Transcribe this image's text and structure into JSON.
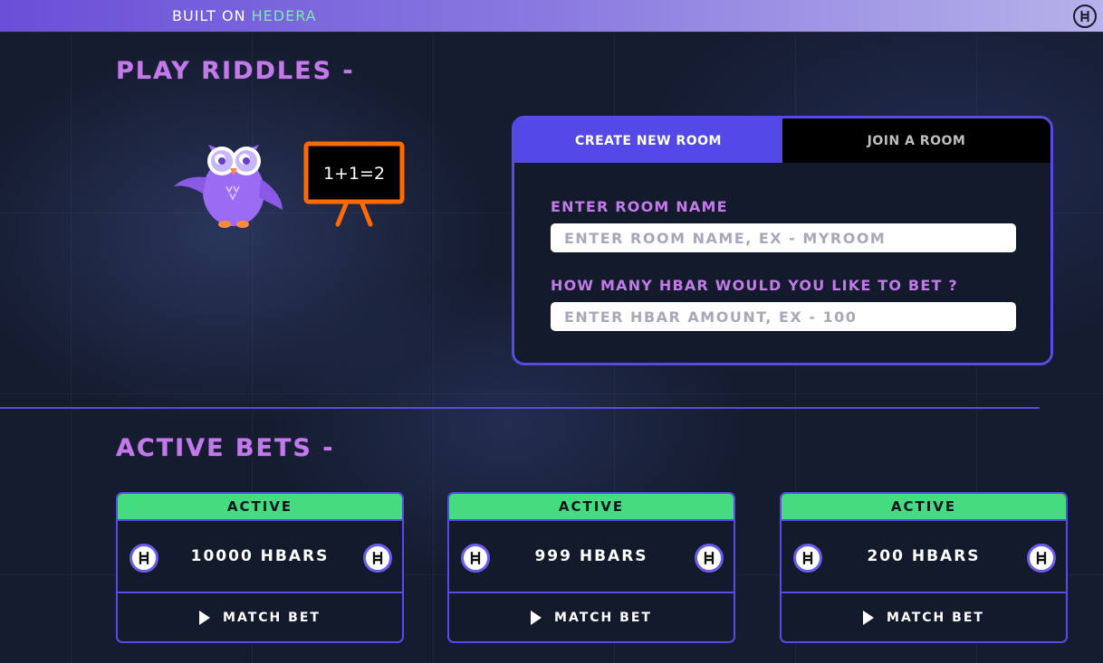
{
  "header": {
    "built_on_prefix": "BUILT ON ",
    "built_on_brand": "HEDERA",
    "logo_icon": "hbar-icon"
  },
  "play_section": {
    "title": "PLAY RIDDLES -",
    "board_text": "1+1=2"
  },
  "room_panel": {
    "tabs": [
      {
        "label": "CREATE NEW ROOM",
        "active": true
      },
      {
        "label": "JOIN A ROOM",
        "active": false
      }
    ],
    "room_name_label": "ENTER ROOM NAME",
    "room_name_placeholder": "ENTER ROOM NAME, EX - MYROOM",
    "room_name_value": "",
    "bet_label": "HOW MANY HBAR WOULD YOU LIKE TO BET ?",
    "bet_placeholder": "ENTER HBAR AMOUNT, EX - 100",
    "bet_value": ""
  },
  "active_bets": {
    "title": "ACTIVE BETS -",
    "bets": [
      {
        "status": "ACTIVE",
        "amount": "10000 HBARS",
        "action": "MATCH BET"
      },
      {
        "status": "ACTIVE",
        "amount": "999 HBARS",
        "action": "MATCH BET"
      },
      {
        "status": "ACTIVE",
        "amount": "200 HBARS",
        "action": "MATCH BET"
      }
    ]
  },
  "colors": {
    "accent": "#5a4ae4",
    "title_purple": "#c27ae8",
    "status_green": "#45dc7f",
    "board_orange": "#ff6b00"
  }
}
